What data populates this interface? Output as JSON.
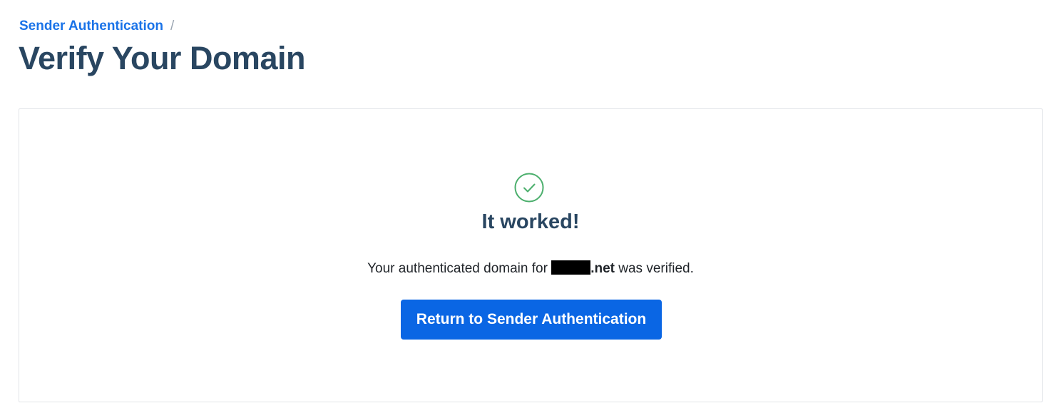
{
  "breadcrumb": {
    "parent_label": "Sender Authentication",
    "separator": "/"
  },
  "page": {
    "title": "Verify Your Domain"
  },
  "result": {
    "icon": "check-circle-icon",
    "icon_color": "#4caf6d",
    "title": "It worked!",
    "message_prefix": "Your authenticated domain for",
    "domain_suffix": ".net",
    "message_suffix": "was verified.",
    "button_label": "Return to Sender Authentication",
    "button_color": "#0a66e4"
  },
  "colors": {
    "link": "#1a73e8",
    "heading": "#294661"
  }
}
